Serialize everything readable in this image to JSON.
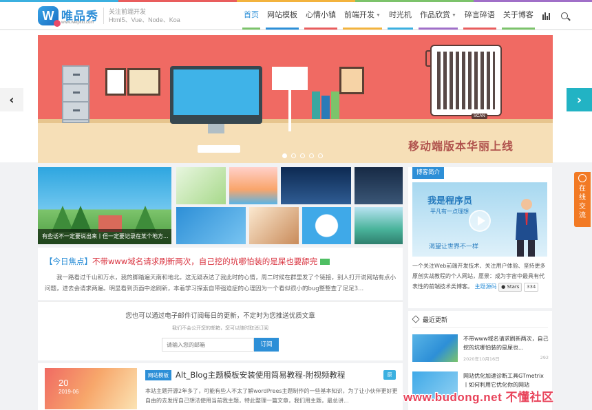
{
  "header": {
    "logo_name": "唯品秀",
    "logo_url": "www.weipxiu.com",
    "slogan_line1": "关注前端开发",
    "slogan_line2": "Html5、Vue、Node、Koa",
    "nav": [
      {
        "label": "首页",
        "color": "#7cc36b"
      },
      {
        "label": "网站模板",
        "color": "#2d8fd7"
      },
      {
        "label": "心情小镇",
        "color": "#e95d5d"
      },
      {
        "label": "前端开发",
        "color": "#f3b33d"
      },
      {
        "label": "时光机",
        "color": "#3bb0e0"
      },
      {
        "label": "作品欣赏",
        "color": "#a06fc8"
      },
      {
        "label": "碎言碎语",
        "color": "#e95d5d"
      },
      {
        "label": "关于博客",
        "color": "#7cc36b"
      }
    ]
  },
  "banner": {
    "caption": "移动端版本华丽上线",
    "scan_label": "SCAN",
    "accent": "#f06a63",
    "slide_count": 5,
    "active_slide": 1
  },
  "gallery": {
    "hero_caption": "有些话不一定要说出来丨但一定要记录在某个地方..."
  },
  "focus": {
    "tag": "【今日焦点】",
    "title": "不带www域名请求刷新两次，自己挖的坑哪怕装的是屎也要舔完",
    "excerpt": "我一路看过千山和万水，我的脚踏遍天南和地北。这无疑表达了我此时的心情，周二时候在群里发了个链接，别人打开说网站有点小问题，进去会请求两遍。明显看到页面中途刷新，本着学习探索自带强迫症的心理因为一个看似很小的bug整整查了足足3..."
  },
  "subscribe": {
    "title": "您也可以通过电子邮件订阅每日的更新，不定时为您推送优质文章",
    "note": "我们不会公开您的邮箱，您可以随时取消订阅",
    "placeholder": "请输入您的邮箱",
    "button": "订阅"
  },
  "post": {
    "day": "20",
    "month": "2019-06",
    "category": "网站模板",
    "title": "Alt_Blog主题模板安装使用简易教程-附视频教程",
    "excerpt": "本站主题开源2年多了，可能有些人不太了解wordPrees主题制作的一些基本知识，为了让小伙伴更好更自由的去发挥自己想法使用当前我主题，特此整理一篇文章，我们用主题，最总讲...",
    "badge": "原"
  },
  "sidebar": {
    "about_head": "博客简介",
    "img_title": "我是程序员",
    "img_sub": "平凡有一点理想",
    "img_slogan": "渴望让世界不一样",
    "about_text": "一个关注Web前端开发技术、关注用户体验、坚持更多原创实战教程的个人网站，愿景：成为宇宙中最具有代表性的前端技术类博客。",
    "source_link": "主题源码",
    "stars_label": "Stars",
    "stars_count": "334",
    "recent_head": "最近更新",
    "recent": [
      {
        "title": "不带www域名请求刷新两次，自己挖的坑哪怕装的是屎也...",
        "date": "2020年10月16日",
        "views": "292"
      },
      {
        "title": "网站优化加速诊断工具GTmetrix丨如何利用它优化你的网站",
        "date": "",
        "views": ""
      }
    ]
  },
  "chat_tab": [
    "在",
    "线",
    "交",
    "流"
  ],
  "watermark": "www.budong.net 不懂社区"
}
